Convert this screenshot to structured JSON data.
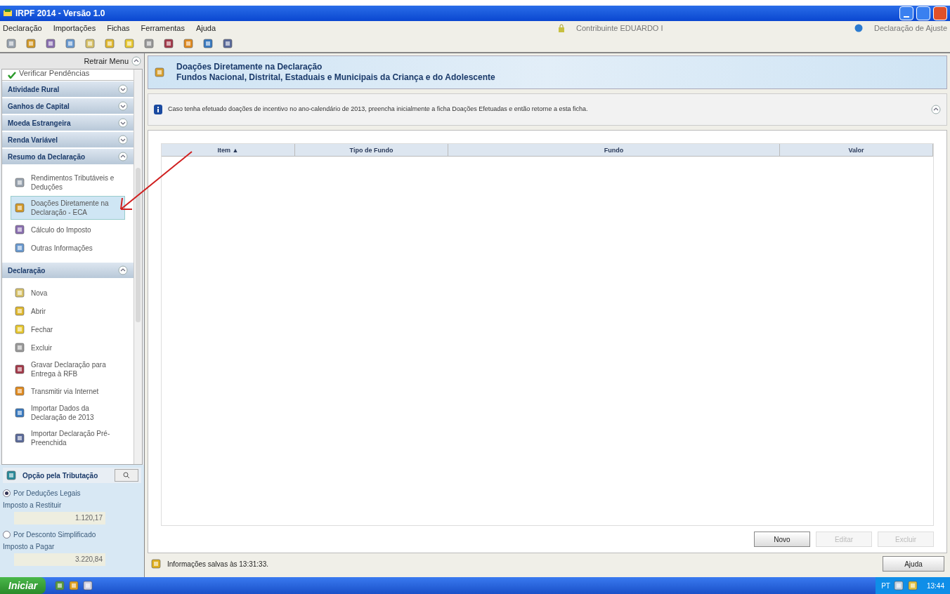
{
  "window": {
    "title": "IRPF 2014 - Versão 1.0"
  },
  "menu": [
    "Declaração",
    "Importações",
    "Fichas",
    "Ferramentas",
    "Ajuda"
  ],
  "contribuinte": "Contribuinte EDUARDO I",
  "declaration_type": "Declaração de Ajuste",
  "sidebar": {
    "collapse_label": "Retrair Menu",
    "top_item": "Verificar Pendências",
    "sections": [
      {
        "title": "Atividade Rural",
        "expanded": false
      },
      {
        "title": "Ganhos de Capital",
        "expanded": false
      },
      {
        "title": "Moeda Estrangeira",
        "expanded": false
      },
      {
        "title": "Renda Variável",
        "expanded": false
      },
      {
        "title": "Resumo da Declaração",
        "expanded": true,
        "items": [
          {
            "label": "Rendimentos Tributáveis e Deduções",
            "selected": false
          },
          {
            "label": "Doações Diretamente na Declaração - ECA",
            "selected": true
          },
          {
            "label": "Cálculo do Imposto",
            "selected": false
          },
          {
            "label": "Outras Informações",
            "selected": false
          }
        ]
      },
      {
        "title": "Declaração",
        "expanded": true,
        "items": [
          {
            "label": "Nova",
            "selected": false
          },
          {
            "label": "Abrir",
            "selected": false
          },
          {
            "label": "Fechar",
            "selected": false
          },
          {
            "label": "Excluir",
            "selected": false
          },
          {
            "label": "Gravar Declaração para Entrega à RFB",
            "selected": false
          },
          {
            "label": "Transmitir via Internet",
            "selected": false
          },
          {
            "label": "Importar Dados da Declaração de 2013",
            "selected": false
          },
          {
            "label": "Importar Declaração Pré-Preenchida",
            "selected": false
          }
        ]
      }
    ]
  },
  "tax_option": {
    "title": "Opção pela Tributação",
    "options": [
      {
        "label": "Por Deduções Legais",
        "selected": true,
        "field_label": "Imposto a Restituir",
        "value": "1.120,17"
      },
      {
        "label": "Por Desconto Simplificado",
        "selected": false,
        "field_label": "Imposto a Pagar",
        "value": "3.220,84"
      }
    ]
  },
  "header": {
    "title": "Doações Diretamente na Declaração",
    "subtitle": "Fundos Nacional, Distrital, Estaduais e Municipais da Criança e do Adolescente"
  },
  "info": "Caso tenha efetuado doações de incentivo no ano-calendário de 2013, preencha inicialmente a ficha Doações Efetuadas e então retorne a esta ficha.",
  "table": {
    "columns": [
      "Item ▲",
      "Tipo de Fundo",
      "Fundo",
      "Valor"
    ]
  },
  "buttons": [
    {
      "label": "Novo",
      "disabled": false
    },
    {
      "label": "Editar",
      "disabled": true
    },
    {
      "label": "Excluir",
      "disabled": true
    }
  ],
  "status": "Informações salvas às 13:31:33.",
  "help_button": "Ajuda",
  "taskbar": {
    "start": "Iniciar",
    "language": "PT",
    "clock": "13:44"
  }
}
